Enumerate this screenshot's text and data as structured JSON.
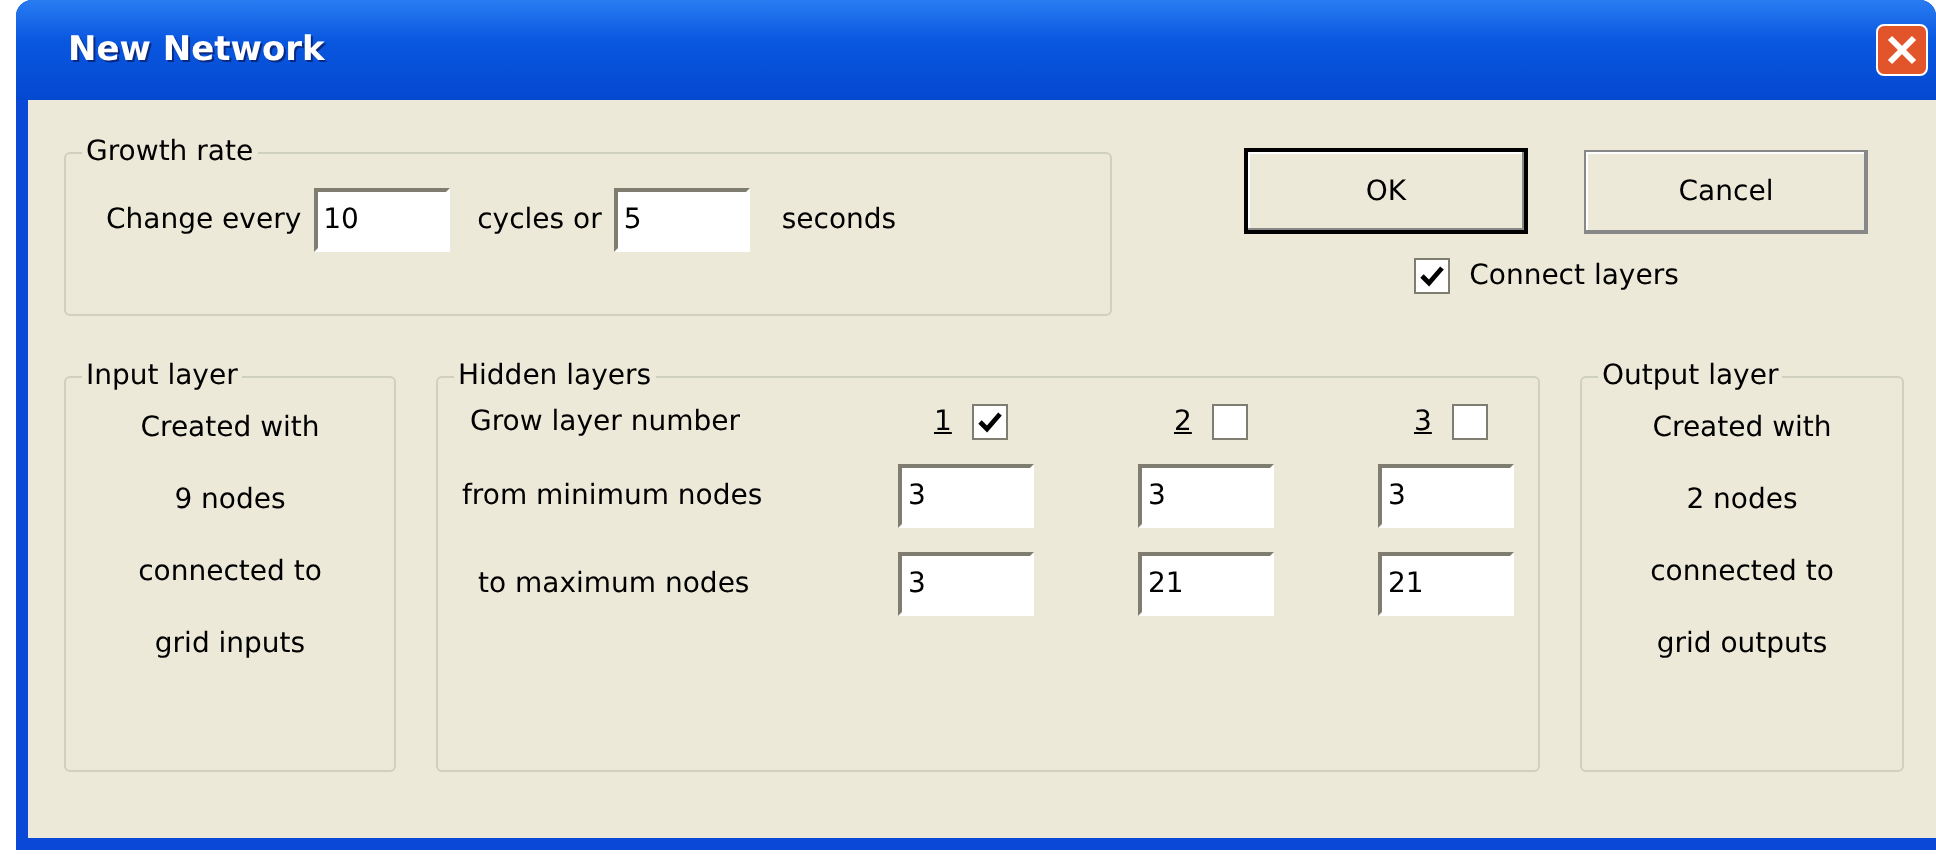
{
  "window": {
    "title": "New Network"
  },
  "growth_rate": {
    "title": "Growth rate",
    "prefix": "Change every",
    "cycles": "10",
    "middle": "cycles or",
    "seconds": "5",
    "suffix": "seconds"
  },
  "buttons": [
    {
      "label": "OK",
      "default": true
    },
    {
      "label": "Cancel",
      "default": false
    }
  ],
  "connect_layers": {
    "label": "Connect layers",
    "checked": true
  },
  "input_layer": {
    "title": "Input layer",
    "lines": [
      "Created with",
      "9 nodes",
      "connected to",
      "grid inputs"
    ]
  },
  "hidden_layers": {
    "title": "Hidden layers",
    "grow_label": "Grow layer number",
    "min_label": "from minimum nodes",
    "max_label": "to maximum nodes",
    "layers": [
      {
        "number": "1",
        "checked": true,
        "min": "3",
        "max": "3"
      },
      {
        "number": "2",
        "checked": false,
        "min": "3",
        "max": "21"
      },
      {
        "number": "3",
        "checked": false,
        "min": "3",
        "max": "21"
      }
    ]
  },
  "output_layer": {
    "title": "Output layer",
    "lines": [
      "Created with",
      "2 nodes",
      "connected to",
      "grid outputs"
    ]
  }
}
